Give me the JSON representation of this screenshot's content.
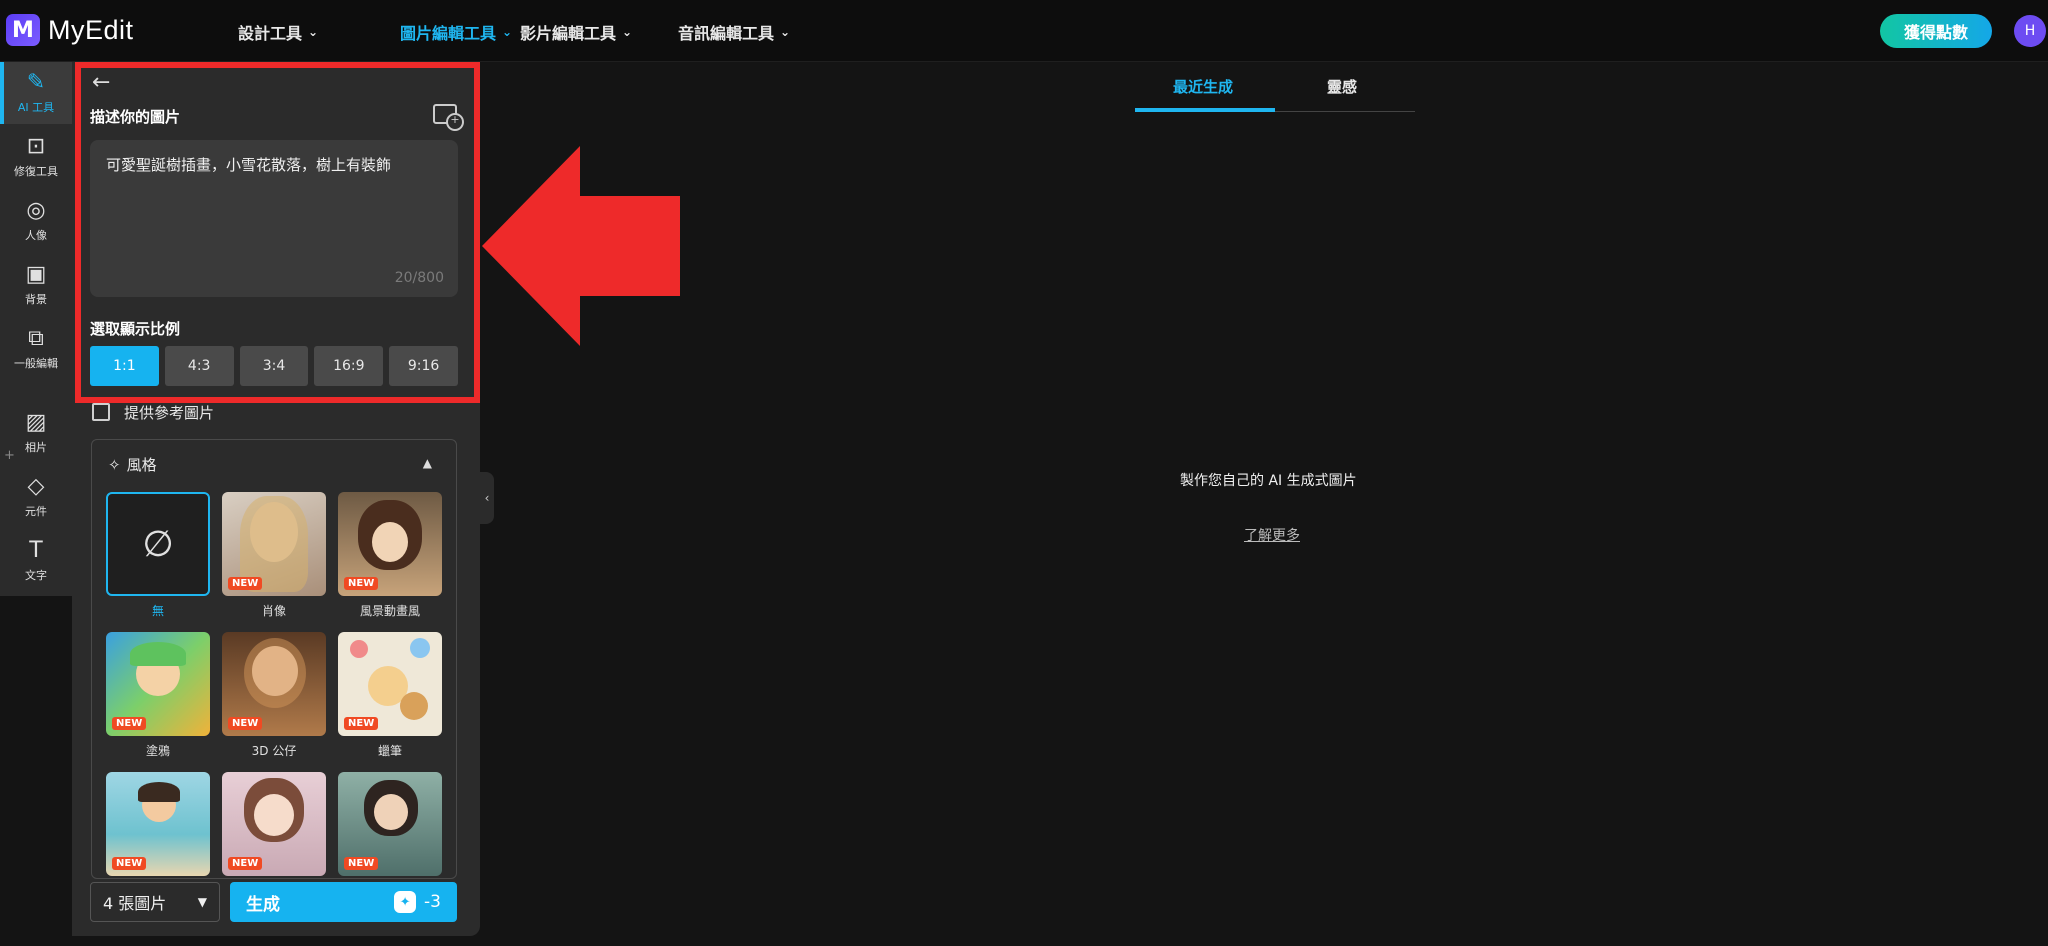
{
  "brand": {
    "name": "MyEdit"
  },
  "nav": [
    {
      "label": "設計工具",
      "active": false
    },
    {
      "label": "圖片編輯工具",
      "active": true
    },
    {
      "label": "影片編輯工具",
      "active": false
    },
    {
      "label": "音訊編輯工具",
      "active": false
    }
  ],
  "header": {
    "points_label": "獲得點數",
    "avatar_initial": "H"
  },
  "rail": [
    {
      "label": "AI 工具",
      "icon": "magic-wand-icon",
      "glyph": "✎"
    },
    {
      "label": "修復工具",
      "icon": "image-fix-icon",
      "glyph": "⊡"
    },
    {
      "label": "人像",
      "icon": "portrait-icon",
      "glyph": "◎"
    },
    {
      "label": "背景",
      "icon": "background-icon",
      "glyph": "▣"
    },
    {
      "label": "一般編輯",
      "icon": "crop-icon",
      "glyph": "⧉"
    },
    {
      "label": "相片",
      "icon": "photo-icon",
      "glyph": "▨"
    },
    {
      "label": "元件",
      "icon": "shapes-icon",
      "glyph": "◇"
    },
    {
      "label": "文字",
      "icon": "text-icon",
      "glyph": "T"
    }
  ],
  "panel": {
    "describe_label": "描述你的圖片",
    "prompt_text": "可愛聖誕樹插畫，小雪花散落，樹上有裝飾",
    "char_count": "20/800",
    "ratio_label": "選取顯示比例",
    "ratios": [
      "1:1",
      "4:3",
      "3:4",
      "16:9",
      "9:16"
    ],
    "selected_ratio": "1:1",
    "reference_label": "提供參考圖片",
    "style_label": "風格",
    "new_badge": "NEW",
    "styles": [
      {
        "label": "無",
        "selected": true,
        "glyph": "∅"
      },
      {
        "label": "肖像",
        "selected": false
      },
      {
        "label": "風景動畫風",
        "selected": false
      },
      {
        "label": "塗鴉",
        "selected": false
      },
      {
        "label": "3D 公仔",
        "selected": false
      },
      {
        "label": "蠟筆",
        "selected": false
      },
      {
        "label": "",
        "selected": false
      },
      {
        "label": "",
        "selected": false
      },
      {
        "label": "",
        "selected": false
      }
    ],
    "count_value": "4 張圖片",
    "generate_label": "生成",
    "generate_cost": "-3"
  },
  "main": {
    "tabs": [
      "最近生成",
      "靈感"
    ],
    "empty_message": "製作您自己的 AI 生成式圖片",
    "learn_more": "了解更多"
  },
  "colors": {
    "accent": "#16b3f0",
    "highlight": "#ee2a2a",
    "brand": "#6d4cf2"
  }
}
